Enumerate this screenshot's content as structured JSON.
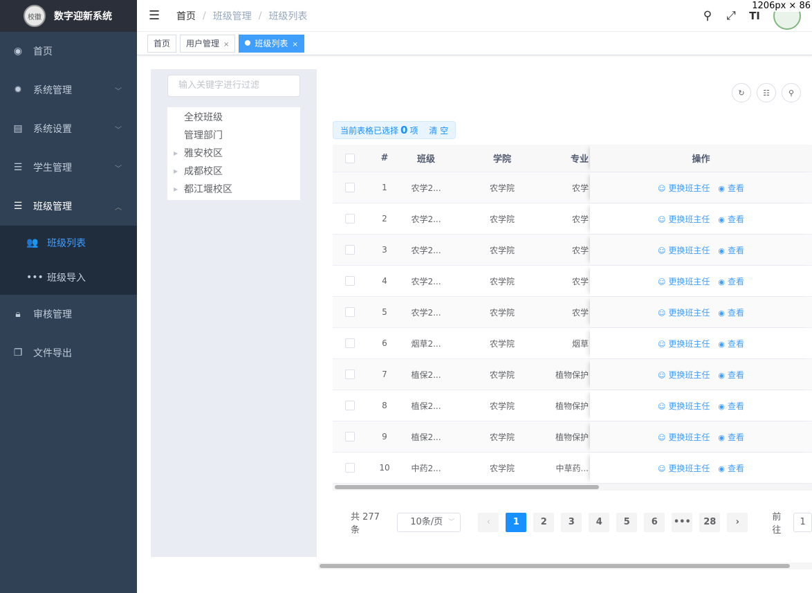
{
  "app": {
    "title": "数字迎新系统",
    "logo_text": "校徽"
  },
  "sidebar": {
    "items": [
      {
        "label": "首页",
        "icon": "dashboard-icon"
      },
      {
        "label": "系统管理",
        "icon": "gear-icon"
      },
      {
        "label": "系统设置",
        "icon": "settings-list-icon"
      },
      {
        "label": "学生管理",
        "icon": "list-icon"
      },
      {
        "label": "班级管理",
        "icon": "list-icon"
      },
      {
        "label": "审核管理",
        "icon": "lock-icon"
      },
      {
        "label": "文件导出",
        "icon": "documents-icon"
      }
    ],
    "subitems": [
      {
        "label": "班级列表",
        "icon": "users-icon"
      },
      {
        "label": "班级导入",
        "icon": "more-dots-icon"
      }
    ]
  },
  "breadcrumb": [
    "首页",
    "班级管理",
    "班级列表"
  ],
  "screen_size_label": "1206px × 86",
  "tags": [
    {
      "label": "首页"
    },
    {
      "label": "用户管理"
    },
    {
      "label": "班级列表"
    }
  ],
  "tree": {
    "placeholder": "输入关键字进行过滤",
    "nodes": [
      "全校班级",
      "管理部门",
      "雅安校区",
      "成都校区",
      "都江堰校区"
    ]
  },
  "selection": {
    "prefix": "当前表格已选择",
    "count": "0",
    "suffix": "项",
    "clear_label": "清 空"
  },
  "table": {
    "headers": {
      "index": "#",
      "class": "班级",
      "college": "学院",
      "major": "专业",
      "action": "操作"
    },
    "action_labels": {
      "change": "更换班主任",
      "view": "查看"
    },
    "rows": [
      {
        "idx": "1",
        "cls": "农学2...",
        "college": "农学院",
        "major": "农学"
      },
      {
        "idx": "2",
        "cls": "农学2...",
        "college": "农学院",
        "major": "农学"
      },
      {
        "idx": "3",
        "cls": "农学2...",
        "college": "农学院",
        "major": "农学"
      },
      {
        "idx": "4",
        "cls": "农学2...",
        "college": "农学院",
        "major": "农学"
      },
      {
        "idx": "5",
        "cls": "农学2...",
        "college": "农学院",
        "major": "农学"
      },
      {
        "idx": "6",
        "cls": "烟草2...",
        "college": "农学院",
        "major": "烟草"
      },
      {
        "idx": "7",
        "cls": "植保2...",
        "college": "农学院",
        "major": "植物保护"
      },
      {
        "idx": "8",
        "cls": "植保2...",
        "college": "农学院",
        "major": "植物保护"
      },
      {
        "idx": "9",
        "cls": "植保2...",
        "college": "农学院",
        "major": "植物保护"
      },
      {
        "idx": "10",
        "cls": "中药2...",
        "college": "农学院",
        "major": "中草药..."
      }
    ]
  },
  "pagination": {
    "total_label": "共 277 条",
    "page_size": "10条/页",
    "pages": [
      "1",
      "2",
      "3",
      "4",
      "5",
      "6",
      "•••",
      "28"
    ],
    "current": "1",
    "jump_label": "前往",
    "jump_value": "1"
  }
}
